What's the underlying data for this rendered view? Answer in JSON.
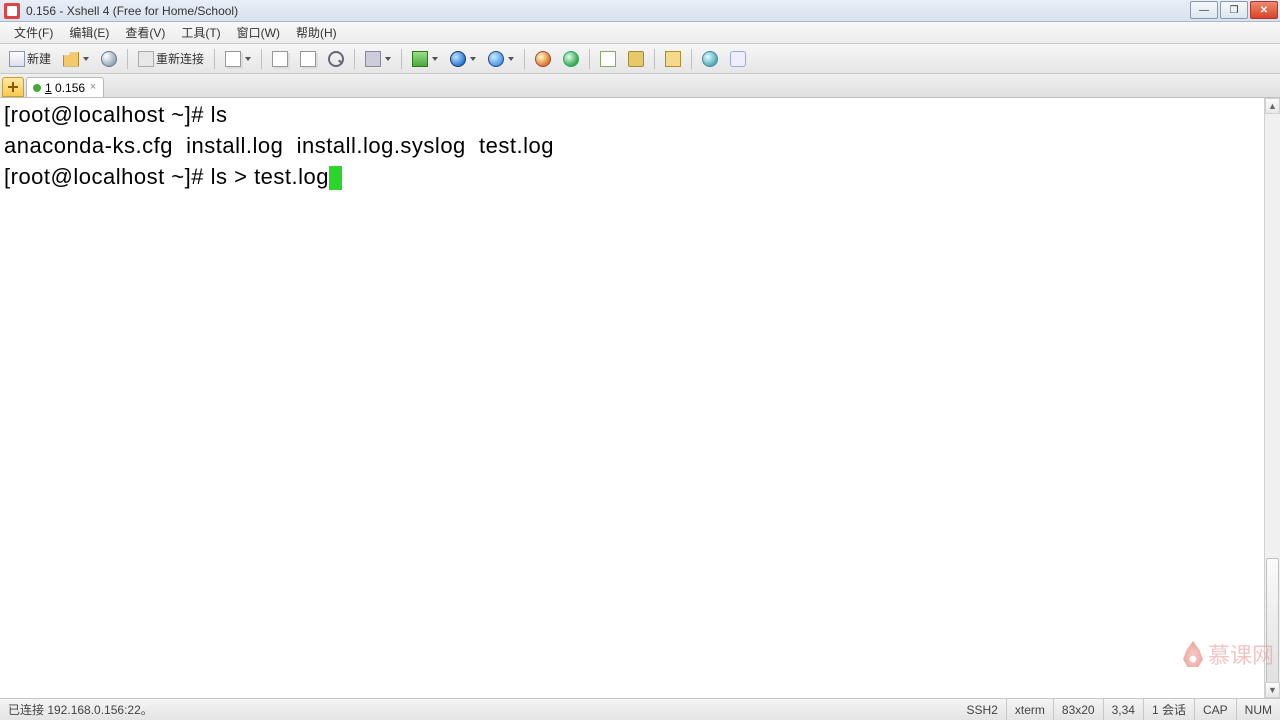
{
  "titlebar": {
    "title": "0.156 - Xshell 4 (Free for Home/School)"
  },
  "menu": {
    "file": "文件(F)",
    "edit": "编辑(E)",
    "view": "查看(V)",
    "tools": "工具(T)",
    "window": "窗口(W)",
    "help": "帮助(H)"
  },
  "toolbar": {
    "new_label": "新建",
    "reconnect_label": "重新连接"
  },
  "tab": {
    "index": "1",
    "title": "0.156"
  },
  "terminal": {
    "line1_prompt": "[root@localhost ~]# ",
    "line1_cmd": "ls",
    "line2_output": "anaconda-ks.cfg  install.log  install.log.syslog  test.log",
    "line3_prompt": "[root@localhost ~]# ",
    "line3_cmd": "ls > test.log"
  },
  "status": {
    "connected": "已连接 192.168.0.156:22。",
    "protocol": "SSH2",
    "termtype": "xterm",
    "size": "83x20",
    "cursor_pos": "3,34",
    "sessions": "1 会话",
    "cap": "CAP",
    "num": "NUM"
  },
  "watermark": "慕课网"
}
